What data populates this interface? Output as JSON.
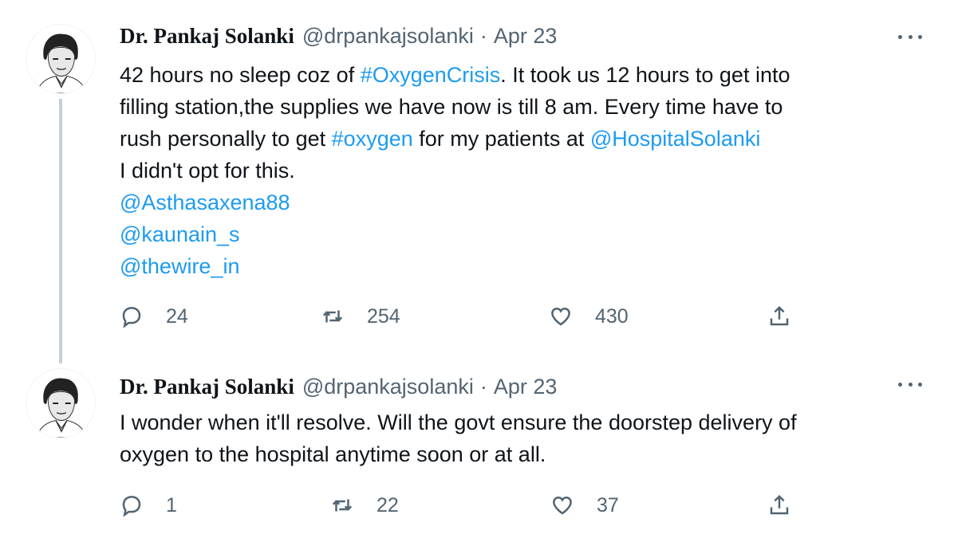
{
  "tweets": [
    {
      "author": {
        "name": "Dr. Pankaj Solanki",
        "handle": "@drpankajsolanki",
        "date": "Apr 23",
        "separator": "·"
      },
      "body": {
        "line1": {
          "pre": "42 hours no sleep coz of ",
          "tag": "#OxygenCrisis",
          "post": ". It took us 12 hours to get into"
        },
        "line2": "filling station,the supplies we have now is till 8 am. Every time have to",
        "line3": {
          "pre": "rush personally to get ",
          "tag": "#oxygen",
          "mid": " for my patients at ",
          "mention": "@HospitalSolanki"
        },
        "line4": "I didn't opt for this.",
        "mentions": [
          "@Asthasaxena88",
          "@kaunain_s",
          "@thewire_in"
        ]
      },
      "actions": {
        "replies": "24",
        "retweets": "254",
        "likes": "430"
      }
    },
    {
      "author": {
        "name": "Dr. Pankaj Solanki",
        "handle": "@drpankajsolanki",
        "date": "Apr 23",
        "separator": "·"
      },
      "body": {
        "line1": "I wonder when it'll resolve. Will the govt ensure the doorstep delivery of",
        "line2": "oxygen to the hospital anytime soon or at all."
      },
      "actions": {
        "replies": "1",
        "retweets": "22",
        "likes": "37"
      }
    }
  ],
  "icons": {
    "reply": "speech-bubble-icon",
    "retweet": "retweet-arrows-icon",
    "like": "heart-icon",
    "share": "share-upload-icon",
    "more": "ellipsis-icon"
  },
  "colors": {
    "link": "#1d9bf0",
    "muted": "#536471",
    "text": "#0f1419",
    "thread_line": "#c4cfd6"
  }
}
